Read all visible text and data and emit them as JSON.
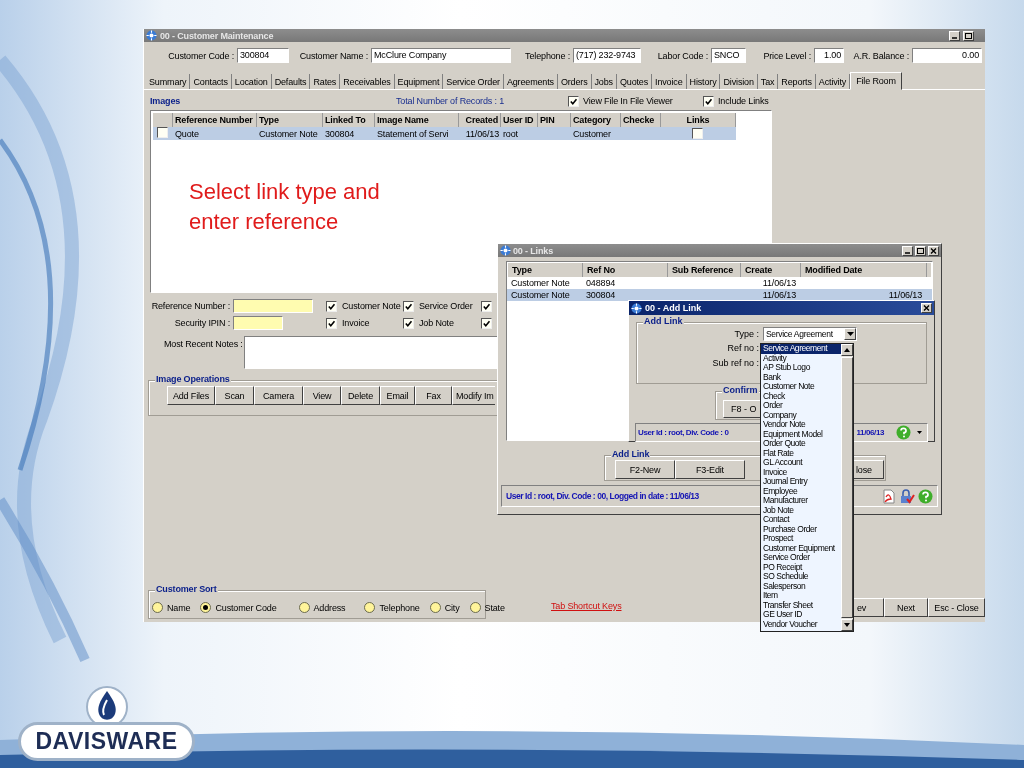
{
  "main_window": {
    "title": "00 - Customer Maintenance",
    "header_fields": [
      {
        "label": "Customer Code :",
        "value": "300804"
      },
      {
        "label": "Customer Name :",
        "value": "McClure Company"
      },
      {
        "label": "Telephone :",
        "value": "(717) 232-9743"
      },
      {
        "label": "Labor Code :",
        "value": "SNCO"
      },
      {
        "label": "Price Level :",
        "value": "1.00"
      },
      {
        "label": "A.R. Balance :",
        "value": "0.00"
      }
    ],
    "tabs": [
      {
        "label": "Summary",
        "selected": false
      },
      {
        "label": "Contacts",
        "selected": false
      },
      {
        "label": "Location",
        "selected": false
      },
      {
        "label": "Defaults",
        "selected": false
      },
      {
        "label": "Rates",
        "selected": false
      },
      {
        "label": "Receivables",
        "selected": false
      },
      {
        "label": "Equipment",
        "selected": false
      },
      {
        "label": "Service Order",
        "selected": false
      },
      {
        "label": "Agreements",
        "selected": false
      },
      {
        "label": "Orders",
        "selected": false
      },
      {
        "label": "Jobs",
        "selected": false
      },
      {
        "label": "Quotes",
        "selected": false
      },
      {
        "label": "Invoice",
        "selected": false
      },
      {
        "label": "History",
        "selected": false
      },
      {
        "label": "Division",
        "selected": false
      },
      {
        "label": "Tax",
        "selected": false
      },
      {
        "label": "Reports",
        "selected": false
      },
      {
        "label": "Activity",
        "selected": false
      },
      {
        "label": "File Room",
        "selected": true
      }
    ],
    "images": {
      "title": "Images",
      "record_count": "Total Number of Records : 1",
      "options": [
        {
          "label": "View File In File Viewer",
          "checked": true
        },
        {
          "label": "Include Links",
          "checked": true
        }
      ],
      "columns": [
        "Reference Number",
        "Type",
        "Linked To",
        "Image Name",
        "Created",
        "User ID",
        "PIN",
        "Category",
        "Checke",
        "Links"
      ],
      "rows": [
        {
          "checked": false,
          "selected": true,
          "reference_number": "Quote",
          "type": "Customer Note",
          "linked_to": "300804",
          "image_name": "Statement of Servi",
          "created": "11/06/13",
          "user_id": "root",
          "category": "Customer",
          "links": false
        }
      ]
    },
    "reference_number": {
      "label": "Reference Number :"
    },
    "security_ipin": {
      "label": "Security IPIN :"
    },
    "filters": [
      {
        "label": "Customer Note",
        "checked": true
      },
      {
        "label": "Service Order",
        "checked": true
      },
      {
        "checked": true
      },
      {
        "label": "Invoice",
        "checked": true
      },
      {
        "label": "Job Note",
        "checked": true
      },
      {
        "checked": true
      }
    ],
    "notes_label": "Most Recent Notes :",
    "image_operations": {
      "title": "Image Operations",
      "buttons": [
        "Add Files",
        "Scan",
        "Camera",
        "View",
        "Delete",
        "Email",
        "Fax",
        "Modify Im"
      ]
    },
    "customer_sort": {
      "title": "Customer Sort",
      "options": [
        {
          "label": "Name",
          "selected": false
        },
        {
          "label": "Customer Code",
          "selected": true
        },
        {
          "label": "Address",
          "selected": false
        },
        {
          "label": "Telephone",
          "selected": false
        },
        {
          "label": "City",
          "selected": false
        },
        {
          "label": "State",
          "selected": false
        }
      ]
    },
    "shortcut_link": "Tab Shortcut Keys",
    "nav_buttons": [
      "ev",
      "Next",
      "Esc - Close"
    ]
  },
  "annotation": "Select link type and enter reference",
  "links_window": {
    "title": "00 - Links",
    "columns": [
      "Type",
      "Ref No",
      "Sub Reference",
      "Create",
      "Modified Date"
    ],
    "rows": [
      {
        "selected": false,
        "type": "Customer Note",
        "ref_no": "048894",
        "created": "11/06/13"
      },
      {
        "selected": true,
        "type": "Customer Note",
        "ref_no": "300804",
        "created": "11/06/13",
        "modified": "11/06/13"
      }
    ],
    "group_title": "Add Link",
    "buttons": [
      "F2-New",
      "F3-Edit",
      "lose"
    ],
    "status": "User Id : root, Div. Code : 00, Logged in date : 11/06/13"
  },
  "add_link_dialog": {
    "title": "00 - Add Link",
    "group_title": "Add Link",
    "field_labels": [
      "Type :",
      "Ref no :",
      "Sub ref no :"
    ],
    "type_value": "Service Agreement",
    "confirm_title": "Confirm",
    "confirm_button": "F8 - O",
    "status": "User Id : root, Div. Code : 0",
    "status_date": "11/06/13"
  },
  "type_list": {
    "items": [
      {
        "label": "Service Agreement",
        "selected": true
      },
      {
        "label": "Activity",
        "selected": false
      },
      {
        "label": "AP Stub Logo",
        "selected": false
      },
      {
        "label": "Bank",
        "selected": false
      },
      {
        "label": "Customer Note",
        "selected": false
      },
      {
        "label": "Check",
        "selected": false
      },
      {
        "label": "Order",
        "selected": false
      },
      {
        "label": "Company",
        "selected": false
      },
      {
        "label": "Vendor Note",
        "selected": false
      },
      {
        "label": "Equipment Model",
        "selected": false
      },
      {
        "label": "Order Quote",
        "selected": false
      },
      {
        "label": "Flat Rate",
        "selected": false
      },
      {
        "label": "GL Account",
        "selected": false
      },
      {
        "label": "Invoice",
        "selected": false
      },
      {
        "label": "Journal Entry",
        "selected": false
      },
      {
        "label": "Employee",
        "selected": false
      },
      {
        "label": "Manufacturer",
        "selected": false
      },
      {
        "label": "Job Note",
        "selected": false
      },
      {
        "label": "Contact",
        "selected": false
      },
      {
        "label": "Purchase Order",
        "selected": false
      },
      {
        "label": "Prospect",
        "selected": false
      },
      {
        "label": "Customer Equipment",
        "selected": false
      },
      {
        "label": "Service Order",
        "selected": false
      },
      {
        "label": "PO Receipt",
        "selected": false
      },
      {
        "label": "SO Schedule",
        "selected": false
      },
      {
        "label": "Salesperson",
        "selected": false
      },
      {
        "label": "Item",
        "selected": false
      },
      {
        "label": "Transfer Sheet",
        "selected": false
      },
      {
        "label": "GE User ID",
        "selected": false
      },
      {
        "label": "Vendor Voucher",
        "selected": false
      }
    ]
  },
  "logo": {
    "text": "DAVISWARE"
  }
}
